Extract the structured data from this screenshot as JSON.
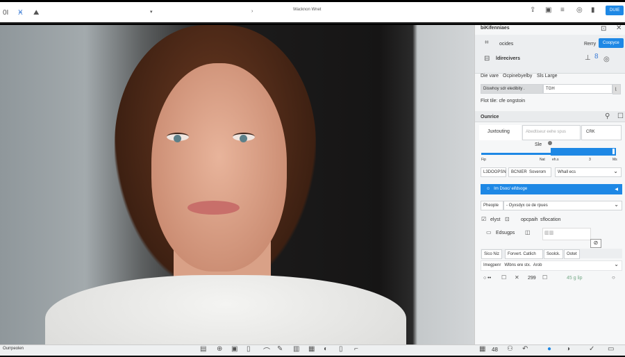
{
  "toolbar": {
    "left_icons": [
      "0I",
      "Ӿ",
      "⛰"
    ],
    "title": "Wacknon Wnet",
    "action_button": "DUIE"
  },
  "panel": {
    "header": "biKifenniaes",
    "row1_label": "ocides",
    "row1_link": "Rerry",
    "row1_button": "Coopyce",
    "row2_label": "ldirecivers",
    "options": [
      "Die vare",
      "Ocpinebyelby",
      "Sls Large"
    ],
    "display_label": "Diswhoy sdr eledibity .",
    "display_value": "TGH",
    "hint": "Flot tile: cfe ongstoin",
    "section2": "Ounrice",
    "tabs": [
      "Juxtouting",
      "Abedtiseur eehe spus",
      "CRK"
    ],
    "slider_label": "Sle",
    "slider_value": 0.48,
    "scale": [
      "Fip",
      "Nat",
      "eh.s",
      "3",
      "Ms"
    ],
    "btns": [
      "L3DOOPSN",
      "BCNIER",
      "Soverom"
    ],
    "select1": "Whall ecs",
    "blue_bar": "Im Dsoc/ eifdsoge",
    "select2_label": "Pheople",
    "select2": "- Oyxsdyx ce de rpues",
    "check1": "elyst",
    "check2_labels": [
      "opcpaih",
      "sflocation"
    ],
    "row_edit": "Edsugps",
    "chips": [
      "Sico Niz",
      "Forvert.",
      "Catlich",
      "Soolck.",
      "Ootet"
    ],
    "row_last": [
      "Imegpenr",
      "Wlbns ere stx.",
      "Arob"
    ],
    "footer_nums": [
      "299",
      "45 g lip"
    ]
  },
  "statusbar": {
    "label": "Ourrpeolen",
    "right_num": "48"
  }
}
